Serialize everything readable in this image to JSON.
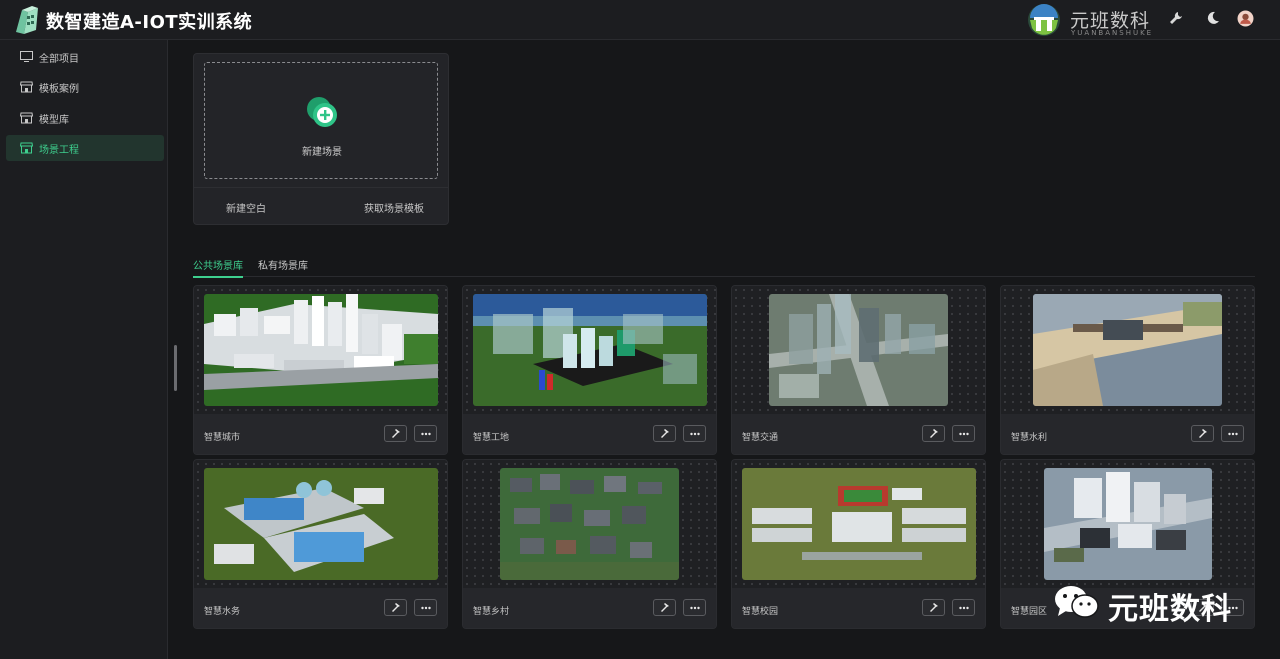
{
  "app": {
    "title": "数智建造A-IOT实训系统"
  },
  "brand": {
    "name": "元班数科",
    "sub": "YUANBANSHUKE"
  },
  "top_icons": [
    "wrench-icon",
    "moon-icon",
    "user-avatar"
  ],
  "sidebar": {
    "items": [
      {
        "label": "全部项目",
        "icon": "monitor-icon",
        "active": false
      },
      {
        "label": "模板案例",
        "icon": "store-icon",
        "active": false
      },
      {
        "label": "模型库",
        "icon": "store-icon",
        "active": false
      },
      {
        "label": "场景工程",
        "icon": "store-icon",
        "active": true
      }
    ]
  },
  "new_scene": {
    "label": "新建场景",
    "actions": [
      "新建空白",
      "获取场景模板"
    ]
  },
  "tabs": [
    {
      "label": "公共场景库",
      "active": true
    },
    {
      "label": "私有场景库",
      "active": false
    }
  ],
  "scenes": [
    {
      "label": "智慧城市",
      "thumb": "city"
    },
    {
      "label": "智慧工地",
      "thumb": "site"
    },
    {
      "label": "智慧交通",
      "thumb": "traffic"
    },
    {
      "label": "智慧水利",
      "thumb": "water"
    },
    {
      "label": "智慧水务",
      "thumb": "watertreat"
    },
    {
      "label": "智慧乡村",
      "thumb": "village"
    },
    {
      "label": "智慧校园",
      "thumb": "campus"
    },
    {
      "label": "智慧园区",
      "thumb": "park"
    }
  ],
  "watermark": {
    "text": "元班数科"
  },
  "colors": {
    "accent": "#3ecf8e",
    "background": "#161719",
    "panel": "#1c1d20"
  }
}
